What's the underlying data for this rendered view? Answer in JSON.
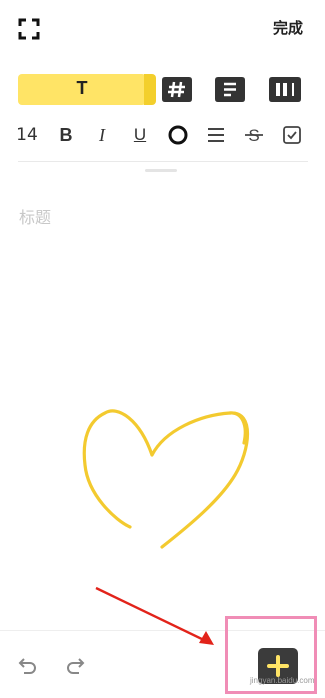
{
  "header": {
    "done_label": "完成",
    "fullscreen_icon": "expand-corners-icon"
  },
  "style_options": [
    {
      "name": "text-style",
      "label": "T",
      "selected": true
    },
    {
      "name": "hashtag-style",
      "icon": "hashtag-icon"
    },
    {
      "name": "list-style",
      "icon": "list-lines-icon"
    },
    {
      "name": "column-style",
      "icon": "columns-icon"
    }
  ],
  "format_toolbar": {
    "font_size": "14",
    "bold": "B",
    "italic": "I",
    "underline": "U",
    "tools": [
      "circle-icon",
      "align-icon",
      "strikethrough-icon",
      "checkbox-icon"
    ]
  },
  "editor": {
    "title_placeholder": "标题",
    "drawing": "yellow heart sketch"
  },
  "bottom_toolbar": {
    "undo_icon": "undo-icon",
    "redo_icon": "redo-icon",
    "add_icon": "add-plus-icon"
  },
  "colors": {
    "accent_yellow": "#FFE466",
    "heart_stroke": "#F3CA2F",
    "highlight_pink": "#F08DB6",
    "arrow_red": "#E2231A",
    "dark_tile": "#3B3B3B"
  },
  "watermark_text": "jingyan.baidu.com"
}
